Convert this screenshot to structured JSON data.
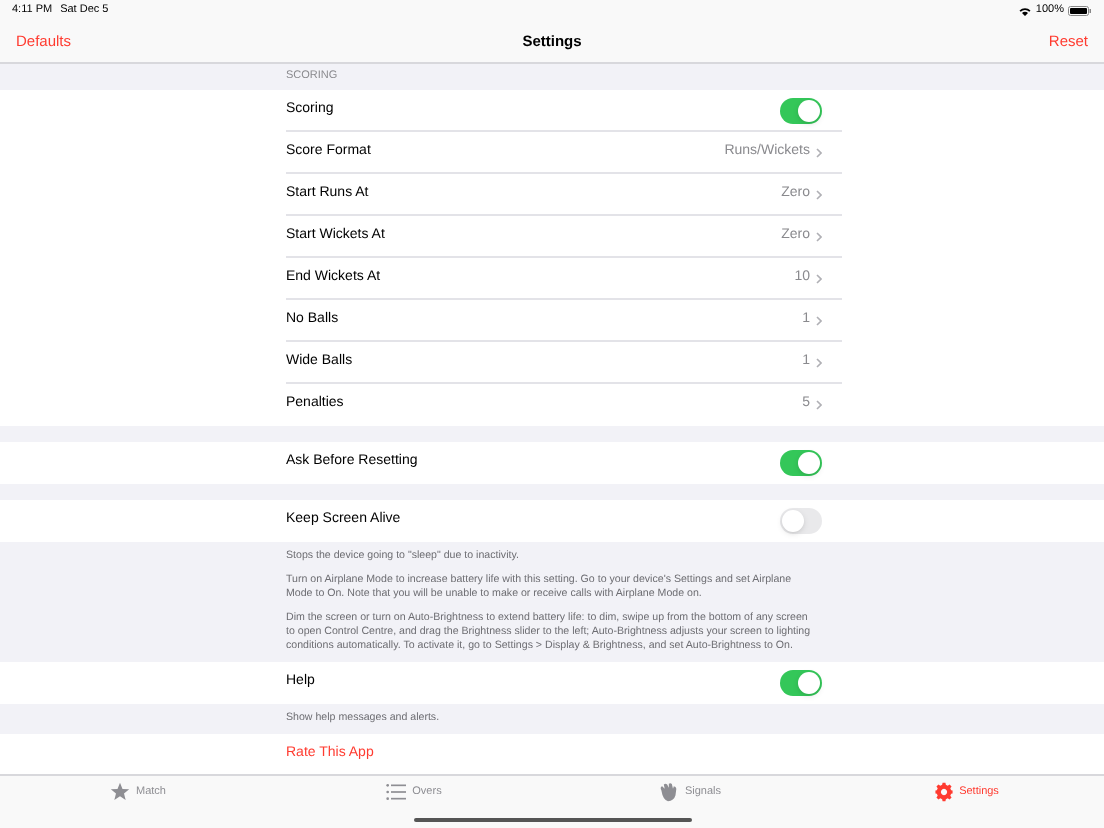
{
  "status_bar": {
    "time": "4:11 PM",
    "date": "Sat Dec 5",
    "battery": "100%"
  },
  "nav": {
    "left": "Defaults",
    "title": "Settings",
    "right": "Reset"
  },
  "sections": [
    {
      "header": "SCORING",
      "rows": [
        {
          "kind": "toggle",
          "label": "Scoring",
          "on": true
        },
        {
          "kind": "disclosure",
          "label": "Score Format",
          "value": "Runs/Wickets"
        },
        {
          "kind": "disclosure",
          "label": "Start Runs At",
          "value": "Zero"
        },
        {
          "kind": "disclosure",
          "label": "Start Wickets At",
          "value": "Zero"
        },
        {
          "kind": "disclosure",
          "label": "End Wickets At",
          "value": "10"
        },
        {
          "kind": "disclosure",
          "label": "No Balls",
          "value": "1"
        },
        {
          "kind": "disclosure",
          "label": "Wide Balls",
          "value": "1"
        },
        {
          "kind": "disclosure",
          "label": "Penalties",
          "value": "5"
        }
      ]
    },
    {
      "rows": [
        {
          "kind": "toggle",
          "label": "Ask Before Resetting",
          "on": true
        }
      ]
    },
    {
      "rows": [
        {
          "kind": "toggle",
          "label": "Keep Screen Alive",
          "on": false
        }
      ],
      "footer": [
        "Stops the device going to \"sleep\" due to inactivity.",
        "Turn on Airplane Mode to increase battery life with this setting. Go to your device's Settings and set Airplane Mode to On. Note that you will be unable to make or receive calls with Airplane Mode on.",
        "Dim the screen or turn on Auto-Brightness to extend battery life: to dim, swipe up from the bottom of any screen to open Control Centre, and drag the Brightness slider to the left; Auto-Brightness adjusts your screen to lighting conditions automatically. To activate it, go to Settings > Display & Brightness, and set Auto-Brightness to On."
      ]
    },
    {
      "rows": [
        {
          "kind": "toggle",
          "label": "Help",
          "on": true
        }
      ],
      "footer": [
        "Show help messages and alerts."
      ]
    },
    {
      "rows": [
        {
          "kind": "link",
          "label": "Rate This App"
        }
      ]
    }
  ],
  "tabs": [
    {
      "label": "Match",
      "kind": "star",
      "selected": false
    },
    {
      "label": "Overs",
      "kind": "list",
      "selected": false
    },
    {
      "label": "Signals",
      "kind": "hand",
      "selected": false
    },
    {
      "label": "Settings",
      "kind": "gear",
      "selected": true
    }
  ]
}
